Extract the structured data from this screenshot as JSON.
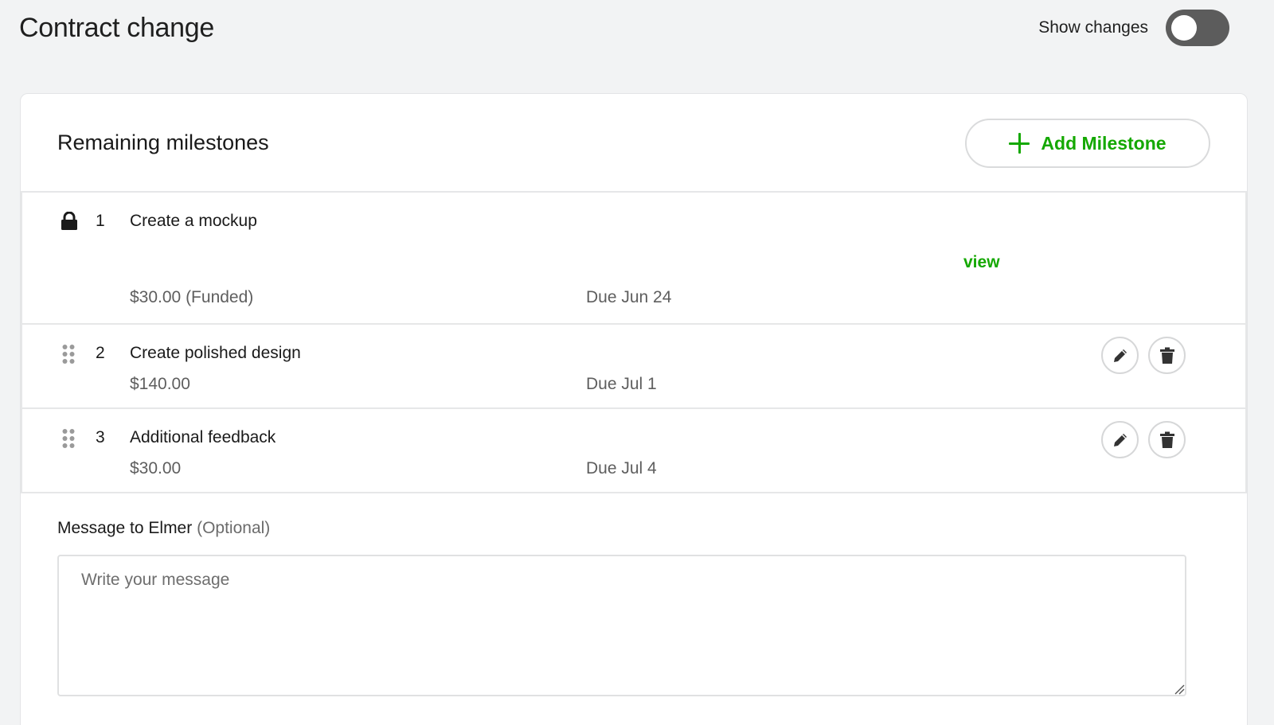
{
  "header": {
    "title": "Contract change",
    "toggle_label": "Show changes",
    "toggle_on": false
  },
  "section": {
    "title": "Remaining milestones",
    "add_button_label": "Add Milestone"
  },
  "milestones": [
    {
      "number": "1",
      "title": "Create a mockup",
      "amount": "$30.00 (Funded)",
      "due": "Due Jun 24",
      "locked": true,
      "view_link": "view"
    },
    {
      "number": "2",
      "title": "Create polished design",
      "amount": "$140.00",
      "due": "Due Jul 1",
      "locked": false
    },
    {
      "number": "3",
      "title": "Additional feedback",
      "amount": "$30.00",
      "due": "Due Jul 4",
      "locked": false
    }
  ],
  "message": {
    "label": "Message to Elmer",
    "optional": "(Optional)",
    "placeholder": "Write your message",
    "value": ""
  },
  "colors": {
    "accent": "#14a800",
    "toggle_off": "#5c5c5c",
    "background": "#f2f3f4"
  },
  "icons": {
    "lock": "lock-icon",
    "drag": "drag-handle-icon",
    "edit": "pencil-icon",
    "delete": "trash-icon",
    "add": "plus-icon"
  }
}
